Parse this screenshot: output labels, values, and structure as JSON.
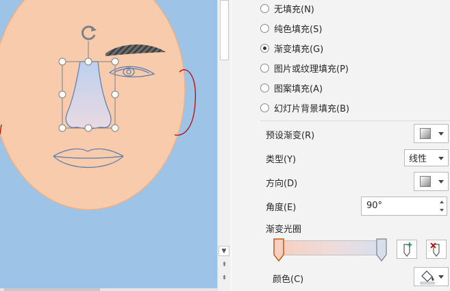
{
  "fill_options": [
    {
      "label": "无填充(N)",
      "selected": false
    },
    {
      "label": "纯色填充(S)",
      "selected": false
    },
    {
      "label": "渐变填充(G)",
      "selected": true
    },
    {
      "label": "图片或纹理填充(P)",
      "selected": false
    },
    {
      "label": "图案填充(A)",
      "selected": false
    },
    {
      "label": "幻灯片背景填充(B)",
      "selected": false
    }
  ],
  "properties": {
    "preset_label": "预设渐变(R)",
    "type_label": "类型(Y)",
    "type_value": "线性",
    "direction_label": "方向(D)",
    "angle_label": "角度(E)",
    "angle_value": "90°",
    "stops_label": "渐变光圈",
    "color_label": "颜色(C)"
  },
  "icons": {
    "rotate_handle": "rotate-icon",
    "scroll_down": "chevron-down-icon",
    "scroll_prev": "double-chevron-up-icon",
    "scroll_next": "double-chevron-down-icon",
    "add_stop": "add-gradient-stop-icon",
    "remove_stop": "remove-gradient-stop-icon",
    "color_picker": "paint-bucket-icon"
  },
  "colors": {
    "slide_background": "#9dc3e6",
    "face": "#f8cbad",
    "face_outline": "#f4b183",
    "ear_outline": "#c00000",
    "eyebrow": "#595959",
    "line_art": "#5a7bab",
    "gradient_start": "#f7cfc0",
    "gradient_end": "#d7dfee",
    "panel_background": "#f3f3f3"
  }
}
